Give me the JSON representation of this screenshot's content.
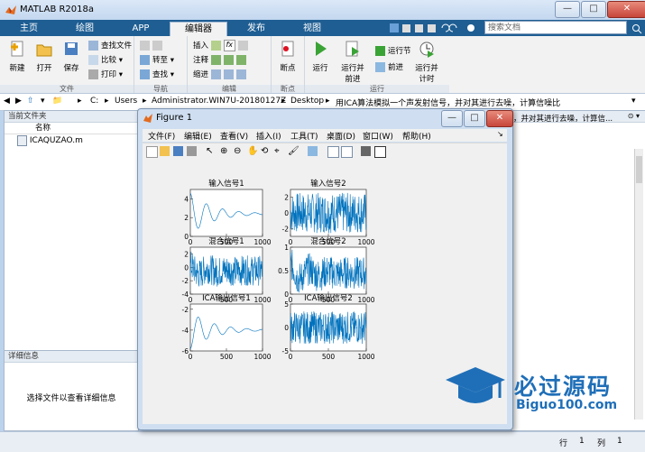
{
  "window": {
    "title": "MATLAB R2018a",
    "search_placeholder": "搜索文档"
  },
  "tabs": [
    {
      "label": "主页"
    },
    {
      "label": "绘图"
    },
    {
      "label": "APP"
    },
    {
      "label": "编辑器"
    },
    {
      "label": "发布"
    },
    {
      "label": "视图"
    }
  ],
  "ribbon": {
    "file": {
      "new": "新建",
      "open": "打开",
      "save": "保存",
      "find_files": "查找文件",
      "compare": "比较",
      "print": "打印",
      "group": "文件"
    },
    "nav": {
      "goto": "转至",
      "find": "查找",
      "group": "导航"
    },
    "edit": {
      "insert": "插入",
      "comment": "注释",
      "indent": "缩进",
      "fx": "fx",
      "group": "编辑"
    },
    "breakpoints": {
      "label": "断点",
      "group": "断点"
    },
    "run": {
      "run": "运行",
      "run_advance_1": "运行并",
      "run_advance_2": "前进",
      "run_section": "运行节",
      "advance": "前进",
      "run_time_1": "运行并",
      "run_time_2": "计时",
      "group": "运行"
    }
  },
  "address": {
    "path": [
      "C:",
      "Users",
      "Administrator.WIN7U-20180127Z",
      "Desktop",
      "用ICA算法模拟一个声发射信号，并对其进行去噪，计算信噪比"
    ]
  },
  "left_panel": {
    "title": "当前文件夹",
    "column": "名称",
    "file": "ICAQUZAO.m"
  },
  "details": {
    "title": "详细信息",
    "text": "选择文件以查看详细信息"
  },
  "right_panel": {
    "snippet": "，并对其进行去噪，计算信..."
  },
  "status": {
    "row_label": "行",
    "row": "1",
    "col_label": "列",
    "col": "1"
  },
  "figure": {
    "title": "Figure 1",
    "menu": [
      "文件(F)",
      "编辑(E)",
      "查看(V)",
      "插入(I)",
      "工具(T)",
      "桌面(D)",
      "窗口(W)",
      "帮助(H)"
    ]
  },
  "chart_data": [
    {
      "type": "line",
      "title": "输入信号1",
      "xlim": [
        0,
        1000
      ],
      "ylim": [
        0,
        5
      ],
      "xticks": [
        "0",
        "500",
        "1000"
      ],
      "yticks": [
        "4",
        "2",
        "0"
      ]
    },
    {
      "type": "line",
      "title": "输入信号2",
      "xlim": [
        0,
        1000
      ],
      "ylim": [
        -3,
        3
      ],
      "xticks": [
        "0",
        "500",
        "1000"
      ],
      "yticks": [
        "2",
        "0",
        "-2"
      ]
    },
    {
      "type": "line",
      "title": "混合信号1",
      "xlim": [
        0,
        1000
      ],
      "ylim": [
        -4,
        3
      ],
      "xticks": [
        "0",
        "500",
        "1000"
      ],
      "yticks": [
        "2",
        "0",
        "-2",
        "-4"
      ]
    },
    {
      "type": "line",
      "title": "混合信号2",
      "xlim": [
        0,
        1000
      ],
      "ylim": [
        0,
        1
      ],
      "xticks": [
        "0",
        "500",
        "1000"
      ],
      "yticks": [
        "1",
        "0.5",
        "0"
      ]
    },
    {
      "type": "line",
      "title": "ICA输出信号1",
      "xlim": [
        0,
        1000
      ],
      "ylim": [
        -6,
        -1.5
      ],
      "xticks": [
        "0",
        "500",
        "1000"
      ],
      "yticks": [
        "-2",
        "-4",
        "-6"
      ]
    },
    {
      "type": "line",
      "title": "ICA输出信号2",
      "xlim": [
        0,
        1000
      ],
      "ylim": [
        -5,
        5
      ],
      "xticks": [
        "0",
        "500",
        "1000"
      ],
      "yticks": [
        "5",
        "0",
        "-5"
      ]
    }
  ],
  "watermark": {
    "brand": "必过源码",
    "url": "Biguo100.com"
  },
  "colors": {
    "line": "#0072bd",
    "tabbar": "#1e5e93",
    "brand": "#1f6fb8"
  }
}
